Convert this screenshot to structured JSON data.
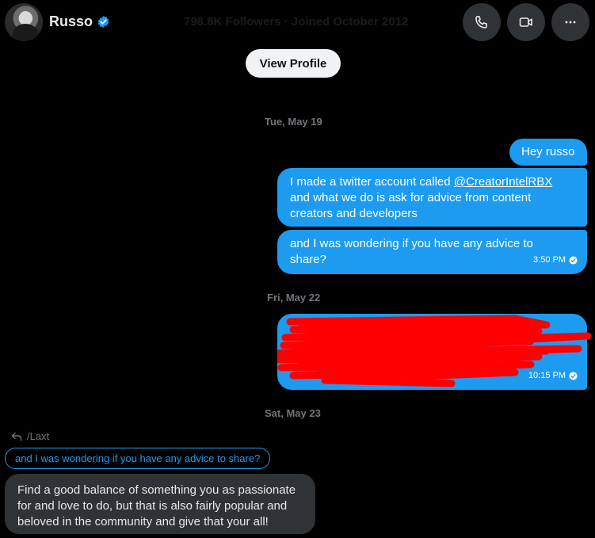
{
  "header": {
    "name": "Russo",
    "faded_subtitle": "798.8K Followers · Joined October 2012",
    "icons": {
      "call": "phone-icon",
      "video": "video-icon",
      "more": "more-icon",
      "verified": "verified-badge-icon"
    }
  },
  "view_profile_label": "View Profile",
  "colors": {
    "accent": "#1d9bf0",
    "background": "#000000",
    "incoming_bubble": "#2f3336",
    "redaction": "#ff0000"
  },
  "thread": {
    "date1": "Tue, May 19",
    "msg1": "Hey russo",
    "msg2_line1_prefix": "I made a twitter account called",
    "msg2_handle": "@CreatorIntelRBX",
    "msg2_line2": "and what we do is ask for advice from content",
    "msg2_line3": "creators and developers",
    "msg3_line1": "and I was wondering if you have any advice to",
    "msg3_line2": "share?",
    "msg3_time": "3:50 PM",
    "date2": "Fri, May 22",
    "msg4_time": "10:15 PM",
    "date3": "Sat, May 23",
    "reply_to": "/Laxt",
    "quoted": "and I was wondering if you have any advice to share?",
    "reply_line1": "Find a good balance of something you as passionate",
    "reply_line2": "for and love to do, but that is also fairly popular and",
    "reply_line3": "beloved in the community and give that your all!"
  }
}
